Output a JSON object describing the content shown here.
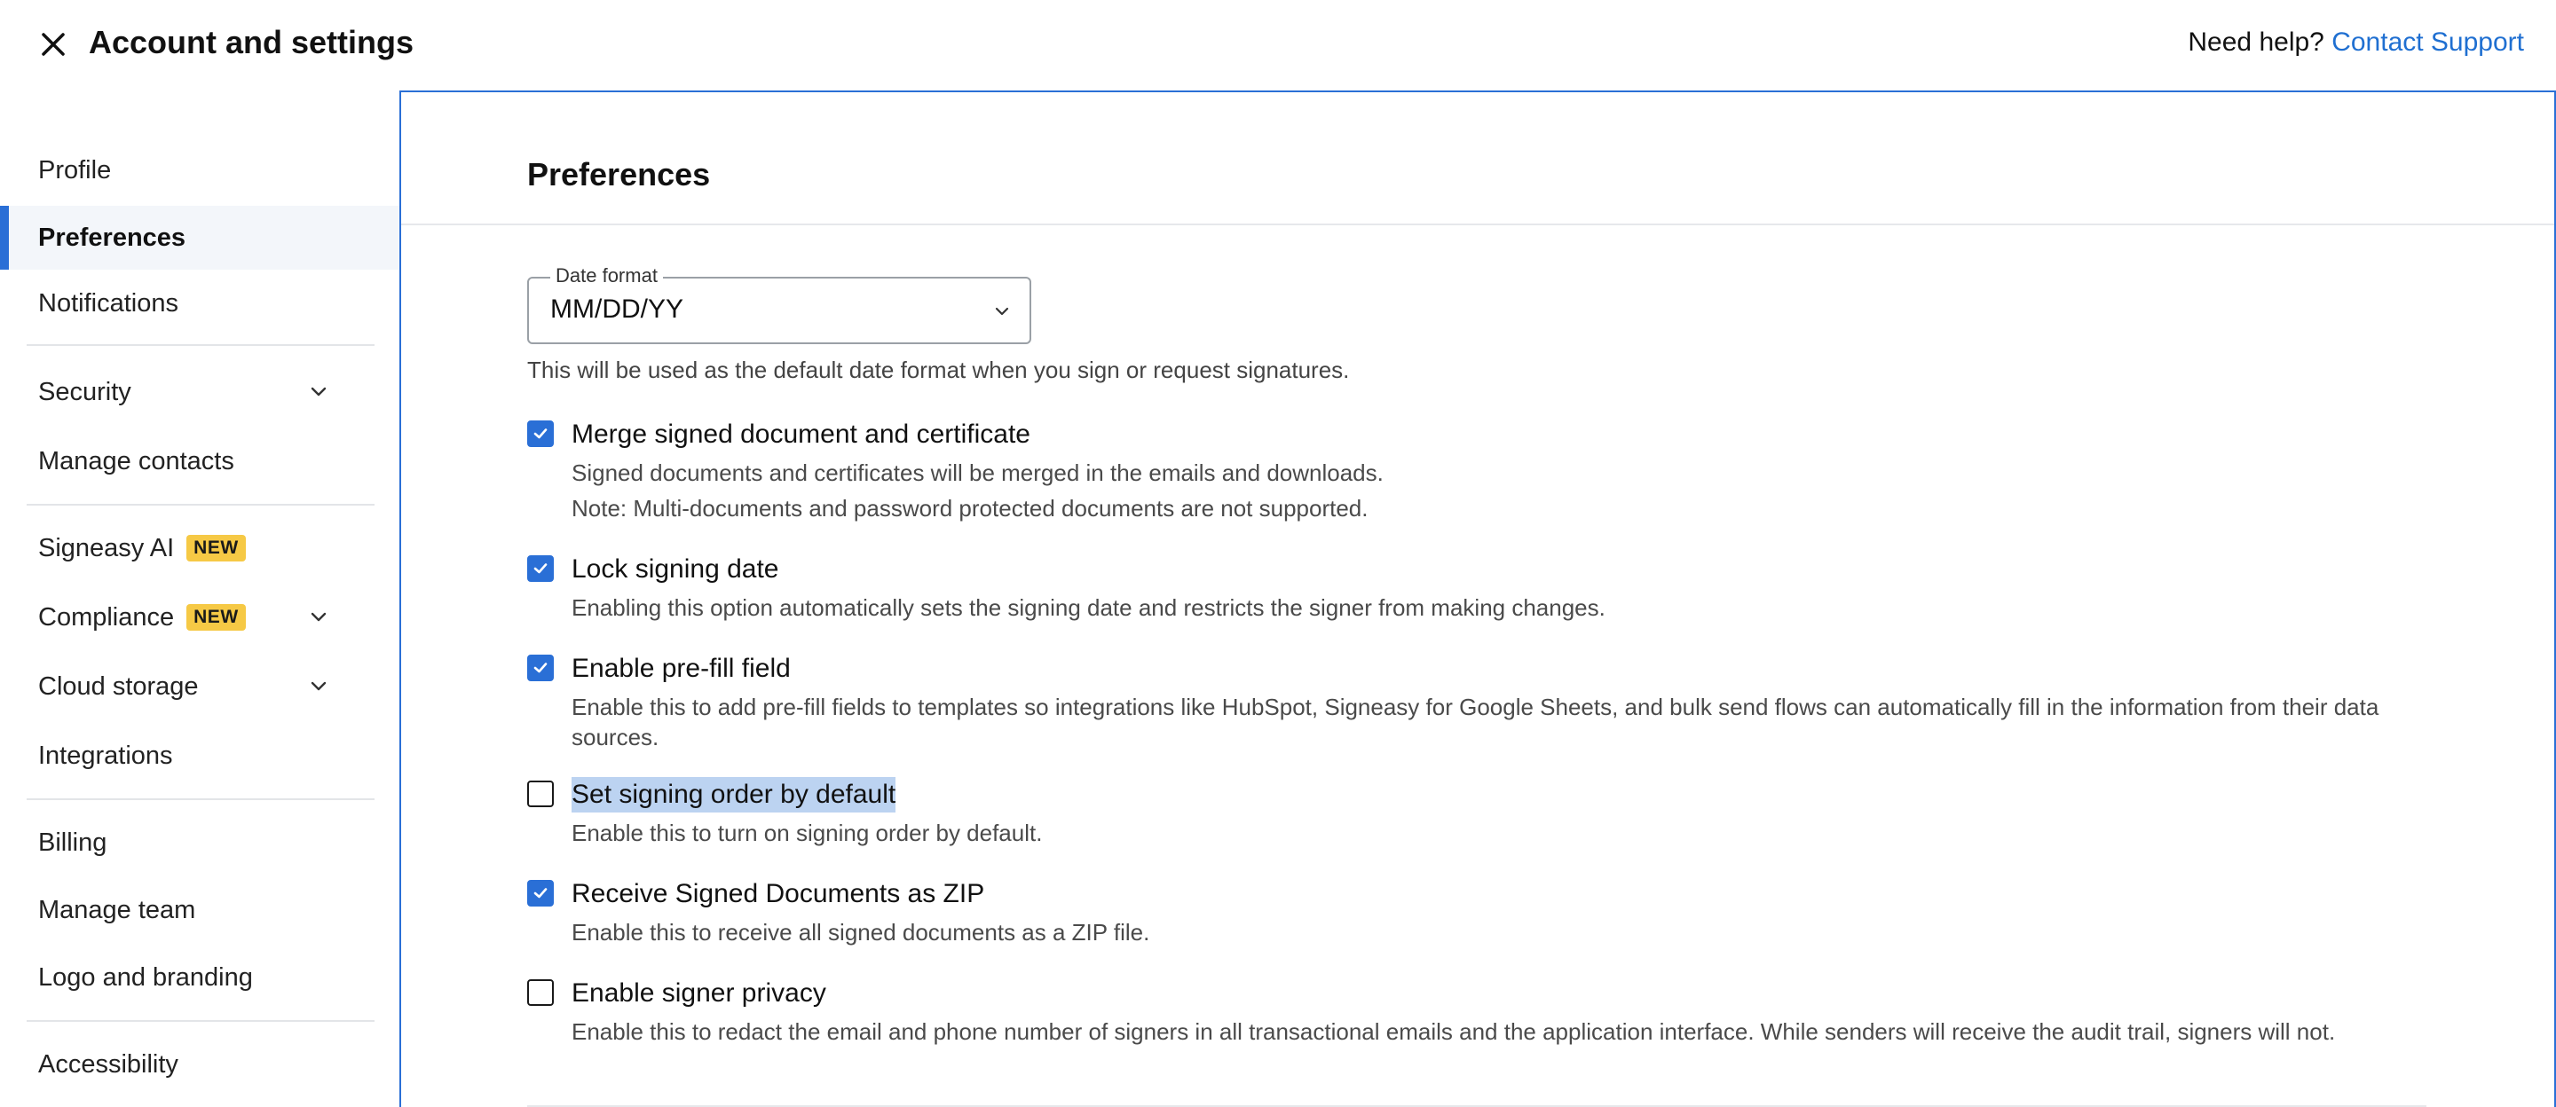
{
  "header": {
    "title": "Account and settings",
    "help_prefix": "Need help?",
    "help_link": "Contact Support"
  },
  "sidebar": {
    "items": [
      {
        "label": "Profile"
      },
      {
        "label": "Preferences",
        "active": true
      },
      {
        "label": "Notifications"
      },
      {
        "label": "Security",
        "expandable": true
      },
      {
        "label": "Manage contacts"
      },
      {
        "label": "Signeasy AI",
        "badge": "NEW"
      },
      {
        "label": "Compliance",
        "badge": "NEW",
        "expandable": true
      },
      {
        "label": "Cloud storage",
        "expandable": true
      },
      {
        "label": "Integrations"
      },
      {
        "label": "Billing"
      },
      {
        "label": "Manage team"
      },
      {
        "label": "Logo and branding"
      },
      {
        "label": "Accessibility"
      }
    ]
  },
  "main": {
    "title": "Preferences",
    "date_format": {
      "legend": "Date format",
      "value": "MM/DD/YY",
      "help": "This will be used as the default date format when you sign or request signatures."
    },
    "options": [
      {
        "label": "Merge signed document and certificate",
        "checked": true,
        "desc1": "Signed documents and certificates will be merged in the emails and downloads.",
        "desc2": "Note: Multi-documents and password protected documents are not supported."
      },
      {
        "label": "Lock signing date",
        "checked": true,
        "desc1": "Enabling this option automatically sets the signing date and restricts the signer from making changes."
      },
      {
        "label": "Enable pre-fill field",
        "checked": true,
        "desc1": "Enable this to add pre-fill fields to templates so integrations like HubSpot, Signeasy for Google Sheets, and bulk send flows can automatically fill in the information from their data sources."
      },
      {
        "label": "Set signing order by default",
        "checked": false,
        "desc1": "Enable this to turn on signing order by default."
      },
      {
        "label": "Receive Signed Documents as ZIP",
        "checked": true,
        "desc1": "Enable this to receive all signed documents as a ZIP file."
      },
      {
        "label": "Enable signer privacy",
        "checked": false,
        "desc1": "Enable this to redact the email and phone number of signers in all transactional emails and the application interface. While senders will receive the audit trail, signers will not."
      }
    ]
  },
  "colors": {
    "accent": "#2a6fd6",
    "badge": "#f6c945",
    "link": "#1f6fd1",
    "highlight": "#bcd3f1"
  }
}
